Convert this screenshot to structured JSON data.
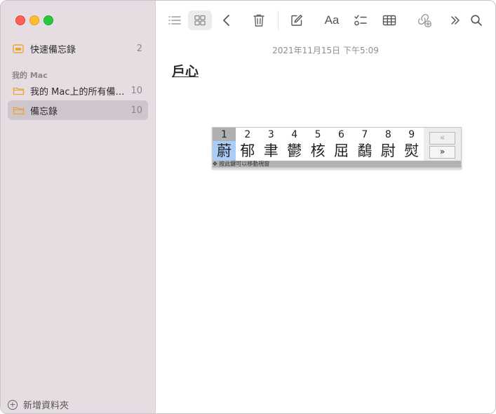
{
  "sidebar": {
    "pinned": {
      "label": "快速備忘錄",
      "count": "2"
    },
    "section_title": "我的 Mac",
    "folders": [
      {
        "label": "我的 Mac上的所有備忘錄",
        "count": "10"
      },
      {
        "label": "備忘錄",
        "count": "10"
      }
    ],
    "new_folder_label": "新增資料夾"
  },
  "toolbar": {
    "icons": [
      "list-view-icon",
      "gallery-view-icon",
      "back-icon",
      "trash-icon",
      "compose-icon",
      "format-icon",
      "checklist-icon",
      "table-icon",
      "collaborate-icon",
      "more-icon",
      "search-icon"
    ],
    "format_label": "Aa"
  },
  "note": {
    "date": "2021年11月15日 下午5:09",
    "title": "戶心"
  },
  "ime": {
    "candidates": [
      {
        "num": "1",
        "char": "蔚"
      },
      {
        "num": "2",
        "char": "郁"
      },
      {
        "num": "3",
        "char": "聿"
      },
      {
        "num": "4",
        "char": "鬱"
      },
      {
        "num": "5",
        "char": "核"
      },
      {
        "num": "6",
        "char": "屈"
      },
      {
        "num": "7",
        "char": "鷸"
      },
      {
        "num": "8",
        "char": "尉"
      },
      {
        "num": "9",
        "char": "熨"
      }
    ],
    "selected_index": 0,
    "prev_page": "«",
    "next_page": "»",
    "status_text": "✥ 按此鍵可以移動視窗"
  },
  "colors": {
    "sidebar_bg": "#e6dde3",
    "selected_row": "#cfc6cd",
    "folder_accent": "#e8a530",
    "ime_highlight": "#a9cdf6"
  }
}
